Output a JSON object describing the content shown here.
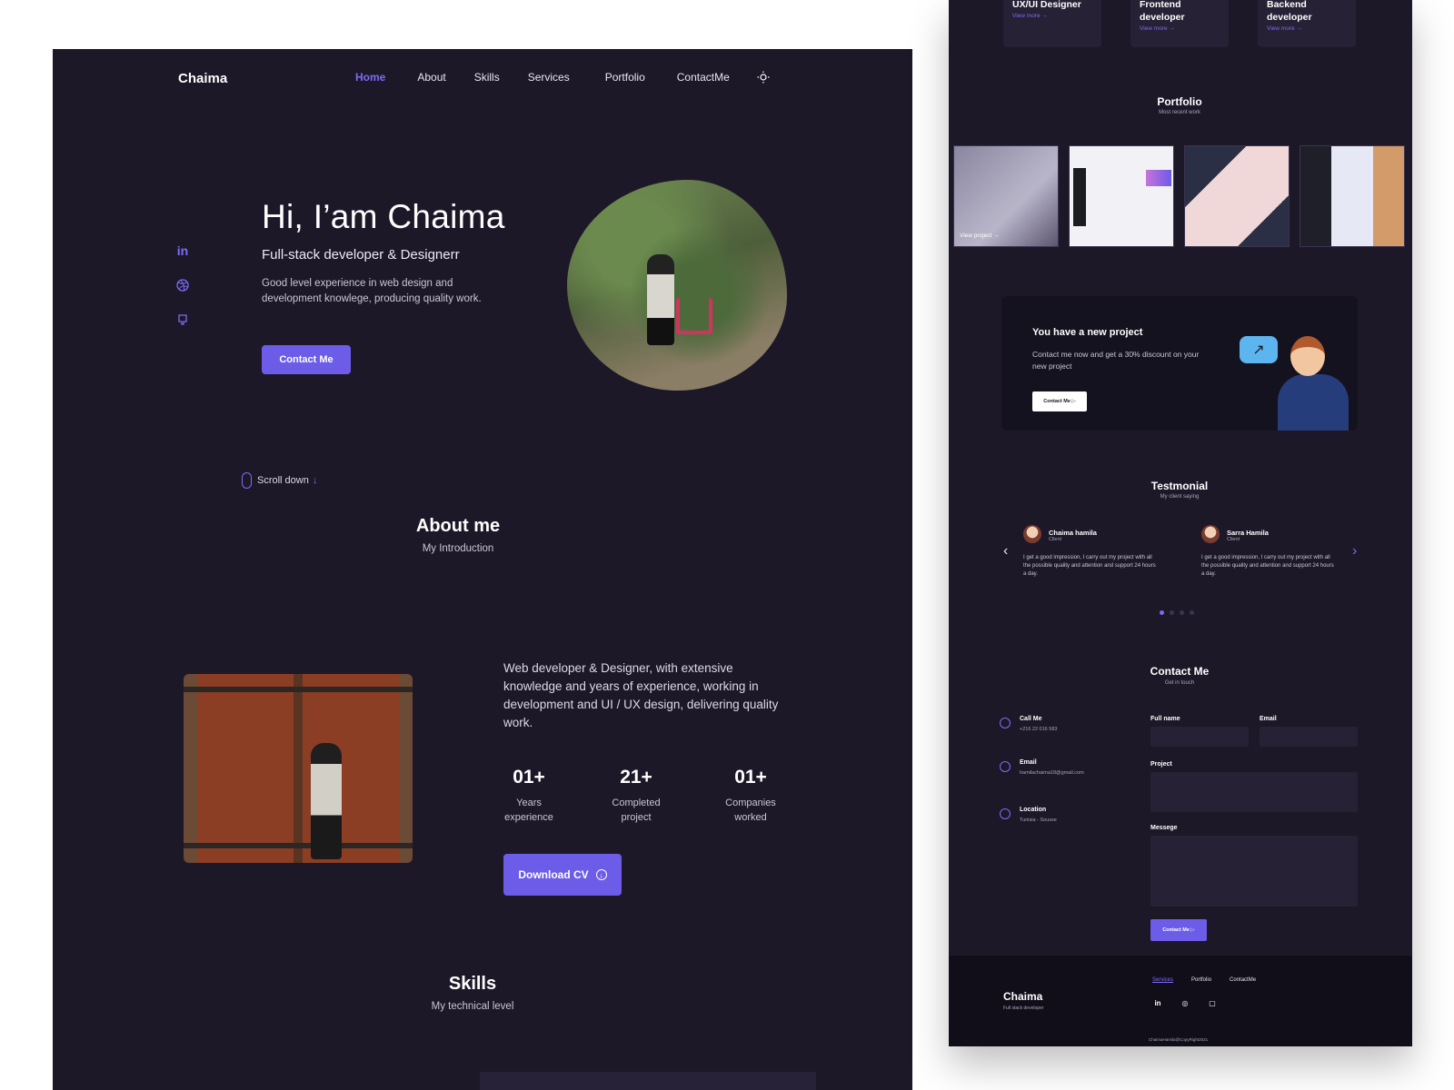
{
  "brand": "Chaima",
  "nav": {
    "items": [
      "Home",
      "About",
      "Skills",
      "Services",
      "Portfolio",
      "ContactMe"
    ],
    "active_index": 0,
    "theme_icon": "sun-icon"
  },
  "socials": [
    "in",
    "dribbble-icon",
    "github-icon"
  ],
  "hero": {
    "title": "Hi, I’am Chaima",
    "subtitle": "Full-stack developer & Designerr",
    "description": "Good level experience in web design and development knowlege, producing quality work.",
    "button": "Contact Me"
  },
  "scroll": {
    "label": "Scroll down",
    "arrow": "↓"
  },
  "about": {
    "title": "About me",
    "subtitle": "My Introduction",
    "text": "Web developer & Designer, with extensive knowledge and years of experience, working in development and UI / UX design, delivering quality work.",
    "stats": [
      {
        "num": "01+",
        "label": "Years experience"
      },
      {
        "num": "21+",
        "label": "Completed project"
      },
      {
        "num": "01+",
        "label": "Companies worked"
      }
    ],
    "download": "Download CV"
  },
  "skills": {
    "title": "Skills",
    "subtitle": "My technical level"
  },
  "services": [
    {
      "title": "UX/UI Designer",
      "more": "View more →"
    },
    {
      "title": "Frontend developer",
      "more": "View more →"
    },
    {
      "title": "Backend developer",
      "more": "View more →"
    }
  ],
  "portfolio": {
    "title": "Portfolio",
    "subtitle": "Most recent work",
    "view_project": "View project →"
  },
  "promo": {
    "title": "You have a new project",
    "text": "Contact me now and get a 30% discount on your new project",
    "button": "Contact Me ▷"
  },
  "testimonial": {
    "title": "Testmonial",
    "subtitle": "My client saying",
    "items": [
      {
        "name": "Chaima hamila",
        "role": "Client",
        "quote": "I get a good impression, I carry out my project with all the possible quality and attention and support 24 hours a day."
      },
      {
        "name": "Sarra Hamila",
        "role": "Client",
        "quote": "I get a good impression, I carry out my project with all the possible quality and attention and support 24 hours a day."
      }
    ]
  },
  "contact": {
    "title": "Contact Me",
    "subtitle": "Get in touch",
    "items": [
      {
        "label": "Call Me",
        "value": "+216 22 016 583"
      },
      {
        "label": "Email",
        "value": "hamilachaima18@gmail.com"
      },
      {
        "label": "Location",
        "value": "Tunisia - Sousse"
      }
    ],
    "fields": {
      "fullname": "Full name",
      "email": "Email",
      "project": "Project",
      "message": "Messege"
    },
    "button": "Contact Me ▷"
  },
  "footer": {
    "brand": "Chaima",
    "tagline": "Full stack developer",
    "links": [
      "Services",
      "Portfolio",
      "ContactMe"
    ],
    "copyright": "ChaimaHamila@CopyRight2021"
  }
}
